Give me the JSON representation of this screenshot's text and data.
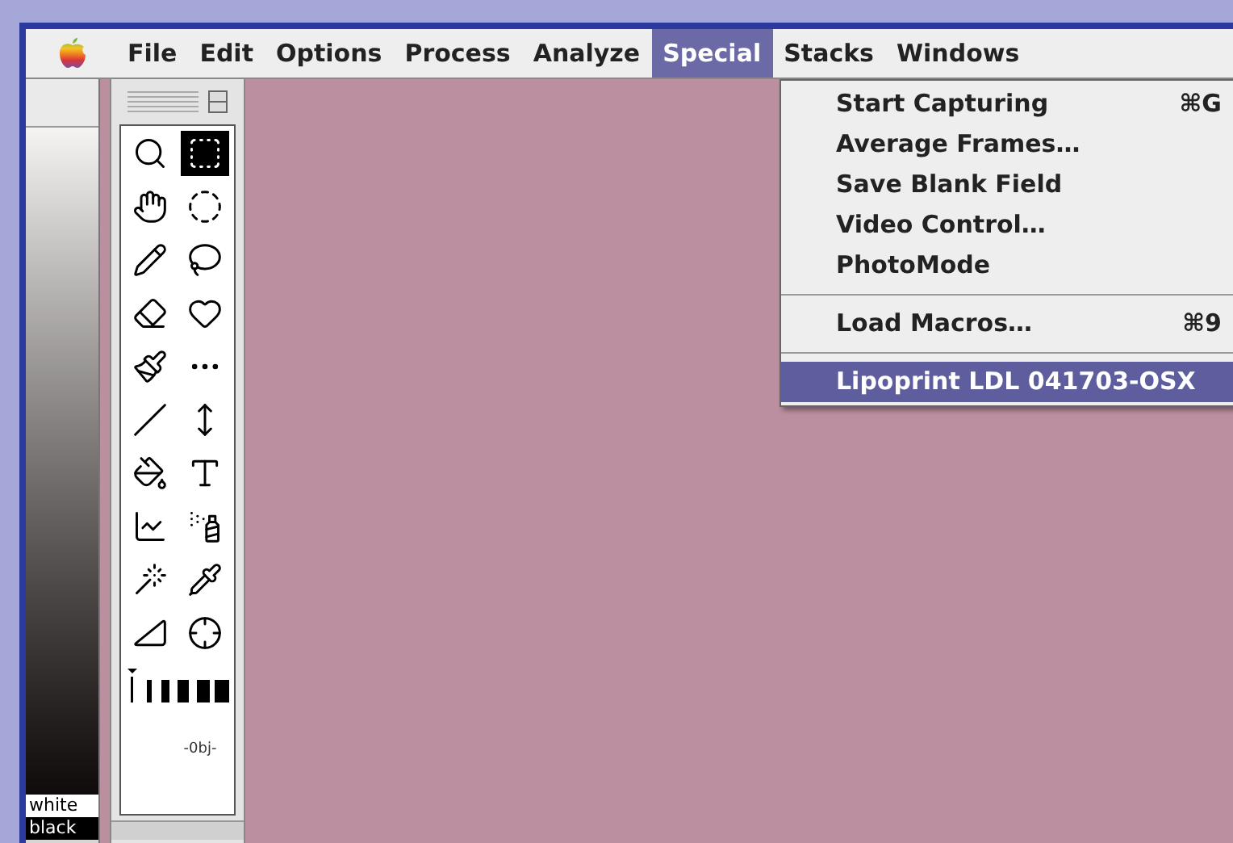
{
  "menubar": [
    {
      "label": "File",
      "selected": false
    },
    {
      "label": "Edit",
      "selected": false
    },
    {
      "label": "Options",
      "selected": false
    },
    {
      "label": "Process",
      "selected": false
    },
    {
      "label": "Analyze",
      "selected": false
    },
    {
      "label": "Special",
      "selected": true
    },
    {
      "label": "Stacks",
      "selected": false
    },
    {
      "label": "Windows",
      "selected": false
    }
  ],
  "menu": [
    {
      "kind": "item",
      "label": "Start Capturing",
      "shortcut": "⌘G",
      "selected": false
    },
    {
      "kind": "item",
      "label": "Average Frames…",
      "selected": false
    },
    {
      "kind": "item",
      "label": "Save Blank Field",
      "selected": false
    },
    {
      "kind": "item",
      "label": "Video Control…",
      "selected": false
    },
    {
      "kind": "item",
      "label": "PhotoMode",
      "selected": false
    },
    {
      "kind": "separator"
    },
    {
      "kind": "item",
      "label": "Load Macros…",
      "shortcut": "⌘9",
      "selected": false
    },
    {
      "kind": "separator"
    },
    {
      "kind": "item",
      "label": "Lipoprint LDL 041703-OSX",
      "selected": true
    }
  ],
  "lut": {
    "top_label": "white",
    "bottom_label": "black"
  },
  "tools": [
    {
      "selected": false
    },
    {
      "selected": true
    },
    {
      "selected": false
    },
    {
      "selected": false
    },
    {
      "selected": false
    },
    {
      "selected": false
    },
    {
      "selected": false
    },
    {
      "selected": false
    },
    {
      "selected": false
    },
    {
      "selected": false
    },
    {
      "selected": false
    },
    {
      "selected": false
    },
    {
      "selected": false
    },
    {
      "selected": false
    },
    {
      "selected": false
    },
    {
      "selected": false
    },
    {
      "selected": false
    },
    {
      "selected": false
    },
    {
      "selected": false
    },
    {
      "selected": false
    }
  ],
  "object_tool": {
    "label": "-0bj-"
  }
}
